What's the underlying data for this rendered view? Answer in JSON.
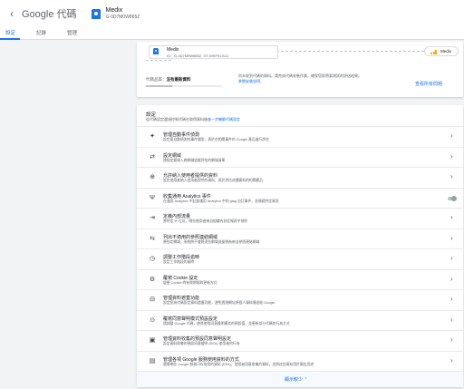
{
  "header": {
    "back_glyph": "‹",
    "title": "Google 代碼",
    "account_name": "Medix",
    "account_id": "G-0D7M0W865Z"
  },
  "tabs": [
    "設定",
    "記錄",
    "管理"
  ],
  "summary": {
    "site_name": "Medix",
    "site_ids": "ID：G-0D7M0W865Z, GT-WKFKLSLC",
    "destination_label": "Medix",
    "quality_label": "代碼品質：",
    "quality_value": "沒有最新資料",
    "quality_level": 0.35,
    "quality_text": "尚未收到代碼的資料。請完成代碼安裝作業，確保您即將要測試的評估結果。",
    "quality_link": "參閱安裝說明。",
    "view_issues": "查看所有問題"
  },
  "settings": {
    "title": "設定",
    "desc_prefix": "從代碼設定選項控制代碼在取得資料後",
    "desc_link": "進一步瞭解代碼設定",
    "rows": [
      {
        "icon": "auto-event-icon",
        "glyph": "✦",
        "title": "管理自動事件偵測",
        "desc": "設定要自動偵測的事件類型，再於在相關事件的 Google 產品進行評估",
        "control": "chevron"
      },
      {
        "icon": "domain-icon",
        "glyph": "⇄",
        "title": "設定網域",
        "desc": "請指定要納入跨網域追蹤評估的網域清單",
        "control": "chevron"
      },
      {
        "icon": "user-data-icon",
        "glyph": "⊕",
        "title": "允許納入使用者提供的資料",
        "desc": "設定使用者納入使用者提供的資料，再於評估這種資料的相關產品",
        "control": "chevron"
      },
      {
        "icon": "analytics-event-icon",
        "glyph": "Ψ",
        "title": "收集通用 Analytics 事件",
        "desc": "在通用 Analytics 中記錄通用 Analytics 中的 gtag 自訂事件，並傳遞特定資訊",
        "control": "toggle"
      },
      {
        "icon": "internal-traffic-icon",
        "glyph": "⇥",
        "title": "定義內部流量",
        "desc": "將特定 IP 位址，哪些使用者來自組織內並從報表中排除",
        "control": "chevron"
      },
      {
        "icon": "referral-icon",
        "glyph": "⇆",
        "title": "列出不適用的參照連結網域",
        "desc": "將指定網域，系統將不會將這些網域流量視為來自參照連結網域",
        "control": "chevron"
      },
      {
        "icon": "session-timeout-icon",
        "glyph": "◷",
        "title": "調整工作階段逾時",
        "desc": "設定工作階段的逾時",
        "control": "chevron"
      },
      {
        "icon": "cookie-icon",
        "glyph": "⚙",
        "title": "覆寫 Cookie 設定",
        "desc": "變更 Cookie 的有效期限和更新方式",
        "control": "chevron"
      },
      {
        "icon": "data-redaction-icon",
        "glyph": "⊟",
        "title": "管理資料遮蓋功能",
        "desc": "設定您為代碼設定資料遮蓋功能，避免透過網址將個人資料傳送給 Google",
        "control": "chevron"
      },
      {
        "icon": "consent-icon",
        "glyph": "⊙",
        "title": "覆寫同意聲明模式預設設定",
        "desc": "請調整 Google 代碼，使其使用同意聲明模式的預設值，並更新部分代碼的行為方式",
        "control": "chevron"
      },
      {
        "icon": "user-provided-icon",
        "glyph": "▣",
        "title": "管理資料收集的預設同意聲明設定",
        "desc": "設定資料收集的預設同意聲明 (EEA) 使用者的行為",
        "control": "chevron"
      },
      {
        "icon": "services-data-icon",
        "glyph": "▤",
        "title": "管理各項 Google 服務使用資料的方式",
        "desc": "選擇哪些 Google 服務可存取您的資料 (EEA)，使用者同意收集的資料，並將這些資料用於廣告用途",
        "control": "chevron"
      }
    ],
    "show_less": "顯示較少 ⌃"
  },
  "colors": {
    "accent": "#1a73e8",
    "tag_blue": "#1a73e8",
    "analytics_orange": "#f9ab00"
  }
}
